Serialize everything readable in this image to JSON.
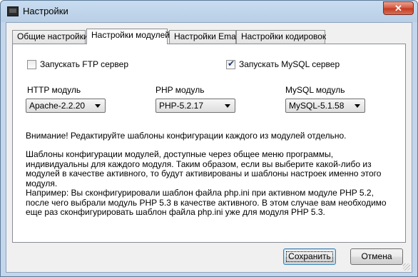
{
  "window": {
    "title": "Настройки",
    "close_glyph": "✕"
  },
  "tabs": [
    {
      "label": "Общие настройки"
    },
    {
      "label": "Настройки модулей"
    },
    {
      "label": "Настройки Email"
    },
    {
      "label": "Настройки кодировок"
    }
  ],
  "checkboxes": {
    "ftp": {
      "label": "Запускать FTP сервер",
      "checked": false
    },
    "mysql": {
      "label": "Запускать MySQL сервер",
      "checked": true
    }
  },
  "modules": {
    "http": {
      "label": "HTTP модуль",
      "value": "Apache-2.2.20"
    },
    "php": {
      "label": "PHP модуль",
      "value": "PHP-5.2.17"
    },
    "mysql": {
      "label": "MySQL модуль",
      "value": "MySQL-5.1.58"
    }
  },
  "notes": {
    "warning": "Внимание! Редактируйте шаблоны конфигурации каждого из модулей отдельно.",
    "templates": "Шаблоны конфигурации модулей, доступные через общее меню программы, индивидуальны для каждого модуля. Таким образом, если вы выберите какой-либо из модулей в качестве активного, то будут активированы и шаблоны настроек именно этого модуля.",
    "example": "Например: Вы сконфигурировали шаблон файла php.ini при активном модуле PHP 5.2, после чего выбрали модуль PHP 5.3 в качестве активного. В этом случае вам необходимо еще раз сконфигурировать шаблон файла php.ini уже для модуля PHP 5.3."
  },
  "buttons": {
    "save": "Сохранить",
    "cancel": "Отмена"
  }
}
